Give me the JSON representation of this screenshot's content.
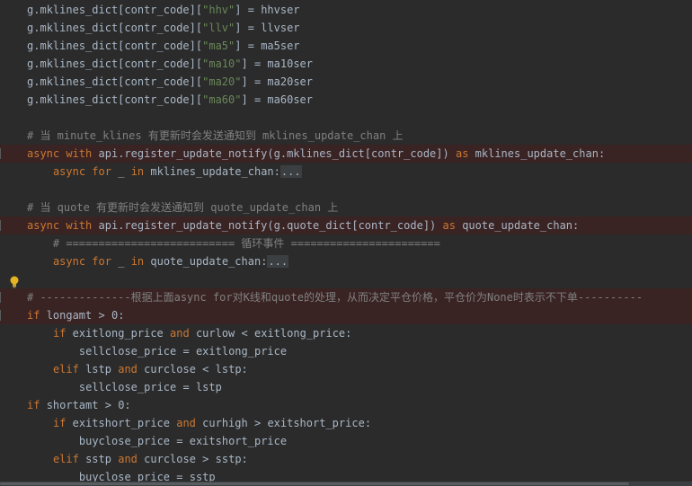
{
  "editor": {
    "lines": [
      {
        "text": "g.mklines_dict[contr_code][\"hhv\"] = hhvser"
      },
      {
        "text": "g.mklines_dict[contr_code][\"llv\"] = llvser"
      },
      {
        "text": "g.mklines_dict[contr_code][\"ma5\"] = ma5ser"
      },
      {
        "text": "g.mklines_dict[contr_code][\"ma10\"] = ma10ser"
      },
      {
        "text": "g.mklines_dict[contr_code][\"ma20\"] = ma20ser"
      },
      {
        "text": "g.mklines_dict[contr_code][\"ma60\"] = ma60ser"
      },
      {
        "text": ""
      },
      {
        "text": "# 当 minute_klines 有更新时会发送通知到 mklines_update_chan 上"
      },
      {
        "text": "async with api.register_update_notify(g.mklines_dict[contr_code]) as mklines_update_chan:"
      },
      {
        "text": "    async for _ in mklines_update_chan:..."
      },
      {
        "text": ""
      },
      {
        "text": "# 当 quote 有更新时会发送通知到 quote_update_chan 上"
      },
      {
        "text": "async with api.register_update_notify(g.quote_dict[contr_code]) as quote_update_chan:"
      },
      {
        "text": "    # ========================== 循环事件 ======================="
      },
      {
        "text": "    async for _ in quote_update_chan:..."
      },
      {
        "text": ""
      },
      {
        "text": "# --------------根据上面async for对K线和quote的处理，从而决定平仓价格，平仓价为None时表示不下单----------"
      },
      {
        "text": "if longamt > 0:"
      },
      {
        "text": "    if exitlong_price and curlow < exitlong_price:"
      },
      {
        "text": "        sellclose_price = exitlong_price"
      },
      {
        "text": "    elif lstp and curclose < lstp:"
      },
      {
        "text": "        sellclose_price = lstp"
      },
      {
        "text": "if shortamt > 0:"
      },
      {
        "text": "    if exitshort_price and curhigh > exitshort_price:"
      },
      {
        "text": "        buyclose_price = exitshort_price"
      },
      {
        "text": "    elif sstp and curclose > sstp:"
      },
      {
        "text": "        buyclose_price = sstp"
      }
    ],
    "highlighted_lines": [
      8,
      12,
      16,
      17
    ],
    "colors": {
      "background": "#2b2b2b",
      "text": "#a9b7c6",
      "keyword": "#cc7832",
      "string": "#6a8759",
      "comment": "#808080",
      "highlight": "#3a2323"
    },
    "icons": {
      "intention": "lightbulb-icon"
    }
  }
}
